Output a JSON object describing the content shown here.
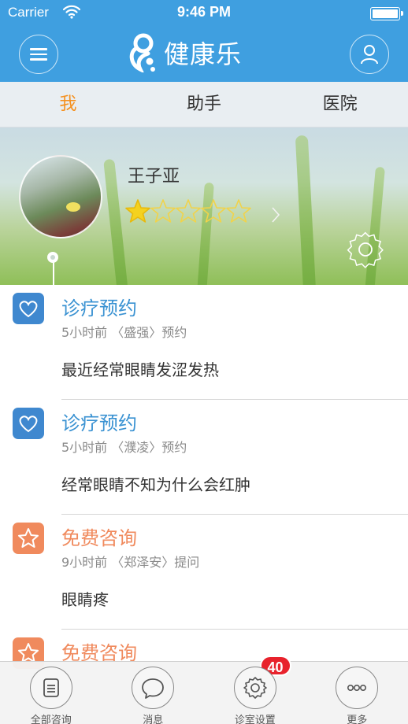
{
  "status_bar": {
    "carrier": "Carrier",
    "time": "9:46 PM"
  },
  "nav": {
    "title": "健康乐",
    "left_icon": "menu-icon",
    "right_icon": "user-icon"
  },
  "tabs": [
    {
      "label": "我",
      "active": true
    },
    {
      "label": "助手",
      "active": false
    },
    {
      "label": "医院",
      "active": false
    }
  ],
  "profile": {
    "name": "王子亚",
    "rating": 1,
    "rating_max": 5
  },
  "feed": [
    {
      "title": "诊疗预约",
      "meta": "5小时前 〈盛强〉预约",
      "content": "最近经常眼睛发涩发热",
      "icon": "heart-icon",
      "color": "#3f88cf",
      "title_color": "#3a92d2"
    },
    {
      "title": "诊疗预约",
      "meta": "5小时前 〈濮凌〉预约",
      "content": "经常眼睛不知为什么会红肿",
      "icon": "heart-icon",
      "color": "#3f88cf",
      "title_color": "#3a92d2"
    },
    {
      "title": "免费咨询",
      "meta": "9小时前 〈郑泽安〉提问",
      "content": "眼睛疼",
      "icon": "star-icon",
      "color": "#f08a5d",
      "title_color": "#f08a5d"
    },
    {
      "title": "免费咨询",
      "meta": "",
      "content": "",
      "icon": "star-icon",
      "color": "#f08a5d",
      "title_color": "#f08a5d"
    }
  ],
  "tabbar": [
    {
      "label": "全部咨询",
      "icon": "list-icon"
    },
    {
      "label": "消息",
      "icon": "message-icon",
      "badge": "40"
    },
    {
      "label": "诊室设置",
      "icon": "gear-icon"
    },
    {
      "label": "更多",
      "icon": "more-icon"
    }
  ],
  "colors": {
    "primary": "#3f9fe0",
    "active_tab": "#f5901e",
    "badge": "#e8222c"
  }
}
